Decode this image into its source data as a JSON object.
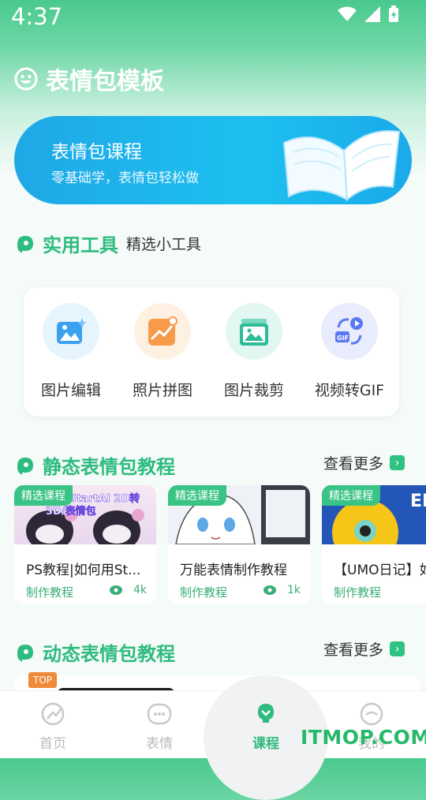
{
  "status": {
    "time": "4:37"
  },
  "header": {
    "title": "表情包模板",
    "icon": "smiley-icon"
  },
  "banner": {
    "title": "表情包课程",
    "subtitle": "零基础学，表情包轻松做",
    "icon": "open-book-icon"
  },
  "tools_section": {
    "title": "实用工具",
    "subtitle": "精选小工具",
    "items": [
      {
        "label": "图片编辑",
        "icon": "image-edit-icon",
        "color": "#3aa0f0"
      },
      {
        "label": "照片拼图",
        "icon": "photo-collage-icon",
        "color": "#f79a4a"
      },
      {
        "label": "图片裁剪",
        "icon": "image-crop-icon",
        "color": "#2dbb9a"
      },
      {
        "label": "视频转GIF",
        "icon": "video-to-gif-icon",
        "color": "#5a78f0"
      }
    ]
  },
  "static_section": {
    "title": "静态表情包教程",
    "more": "查看更多",
    "cards": [
      {
        "tag": "精选课程",
        "thumb_text": "PS+StartAI 2D转3D/表情包",
        "title": "PS教程|如何用St...",
        "category": "制作教程",
        "views": "4k"
      },
      {
        "tag": "精选课程",
        "thumb_text": "",
        "title": "万能表情制作教程",
        "category": "制作教程",
        "views": "1k"
      },
      {
        "tag": "精选课程",
        "thumb_text": "EL",
        "title": "【UMO日记】如",
        "category": "制作教程",
        "views": ""
      }
    ]
  },
  "dynamic_section": {
    "title": "动态表情包教程",
    "more": "查看更多",
    "badge": "TOP"
  },
  "bottom_nav": [
    {
      "label": "首页",
      "icon": "home-icon",
      "active": false
    },
    {
      "label": "表情",
      "icon": "emoji-icon",
      "active": false
    },
    {
      "label": "课程",
      "icon": "course-icon",
      "active": true
    },
    {
      "label": "我的",
      "icon": "profile-icon",
      "active": false
    }
  ],
  "watermark": "ITMOP.COM",
  "colors": {
    "accent": "#2dbb7f",
    "banner": "#1cb6ee"
  }
}
